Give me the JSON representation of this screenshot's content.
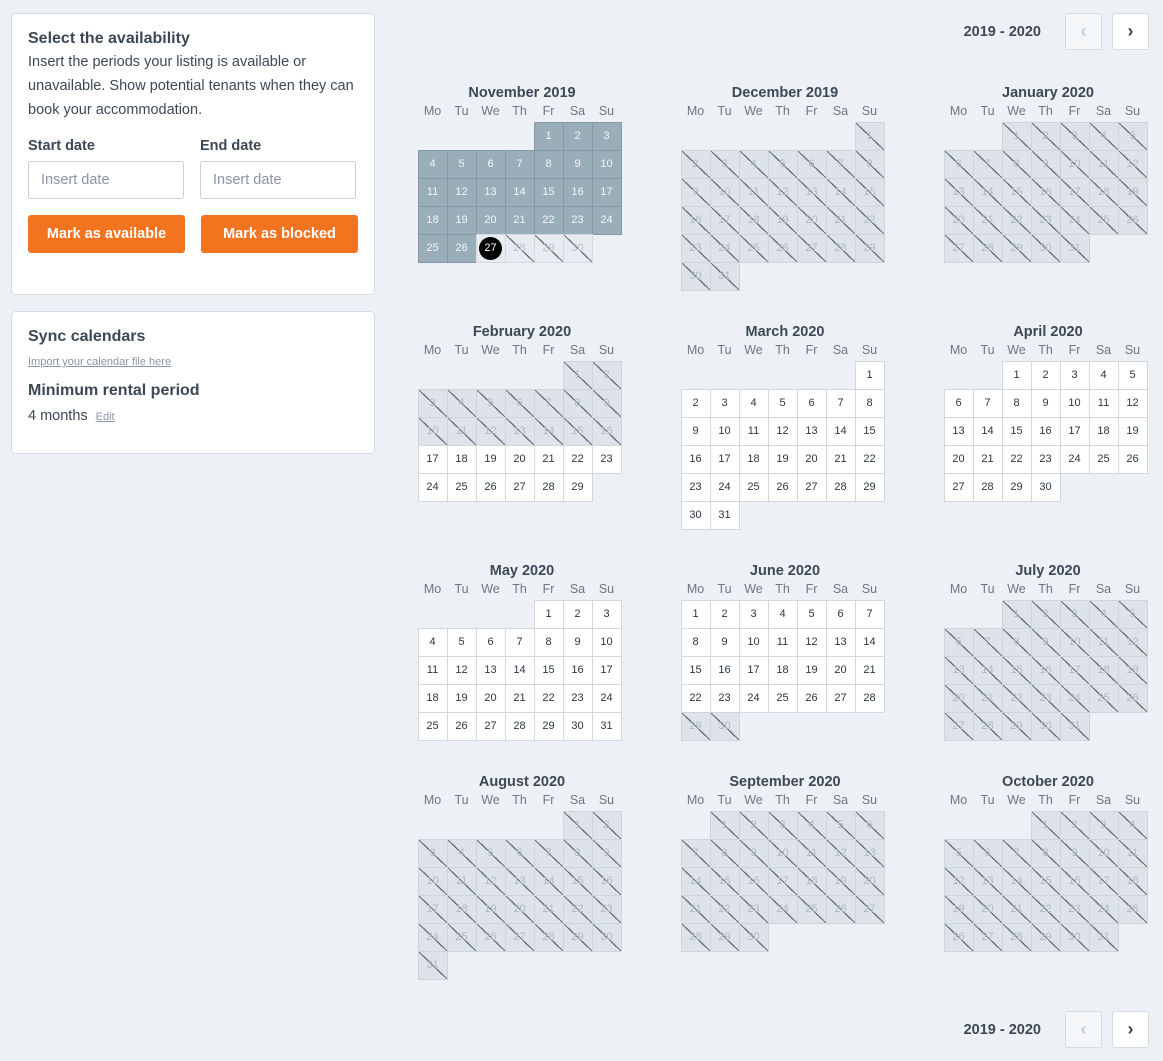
{
  "availability": {
    "title": "Select the availability",
    "description": "Insert the periods your listing is available or unavailable. Show potential tenants when they can book your accommodation.",
    "start_label": "Start date",
    "start_placeholder": "Insert date",
    "end_label": "End date",
    "end_placeholder": "Insert date",
    "available_button": "Mark as available",
    "blocked_button": "Mark as blocked"
  },
  "sync": {
    "title": "Sync calendars",
    "import_link": "Import your calendar file here",
    "min_title": "Minimum rental period",
    "min_value": "4 months",
    "edit_link": "Edit"
  },
  "nav": {
    "year_range": "2019 - 2020",
    "prev_icon": "chevron-left-icon",
    "next_icon": "chevron-right-icon",
    "prev_glyph": "‹",
    "next_glyph": "›"
  },
  "weekdays": [
    "Mo",
    "Tu",
    "We",
    "Th",
    "Fr",
    "Sa",
    "Su"
  ],
  "months": [
    {
      "title": "November 2019",
      "offset": 4,
      "days": 30,
      "selected": [
        1,
        26
      ],
      "today": 27,
      "past_after_today": true
    },
    {
      "title": "December 2019",
      "offset": 6,
      "days": 31,
      "state": "past"
    },
    {
      "title": "January 2020",
      "offset": 2,
      "days": 31,
      "state": "past"
    },
    {
      "title": "February 2020",
      "offset": 5,
      "days": 29,
      "state": "mixed",
      "past_until": 16
    },
    {
      "title": "March 2020",
      "offset": 6,
      "days": 31,
      "state": "available"
    },
    {
      "title": "April 2020",
      "offset": 2,
      "days": 30,
      "state": "available"
    },
    {
      "title": "May 2020",
      "offset": 4,
      "days": 31,
      "state": "available"
    },
    {
      "title": "June 2020",
      "offset": 0,
      "days": 30,
      "state": "mixed_end",
      "past_from": 29
    },
    {
      "title": "July 2020",
      "offset": 2,
      "days": 31,
      "state": "past"
    },
    {
      "title": "August 2020",
      "offset": 5,
      "days": 31,
      "state": "past"
    },
    {
      "title": "September 2020",
      "offset": 1,
      "days": 30,
      "state": "past"
    },
    {
      "title": "October 2020",
      "offset": 3,
      "days": 31,
      "state": "past"
    }
  ],
  "colors": {
    "accent": "#f4731f",
    "selected": "#9aaeba",
    "today": "#000000"
  }
}
